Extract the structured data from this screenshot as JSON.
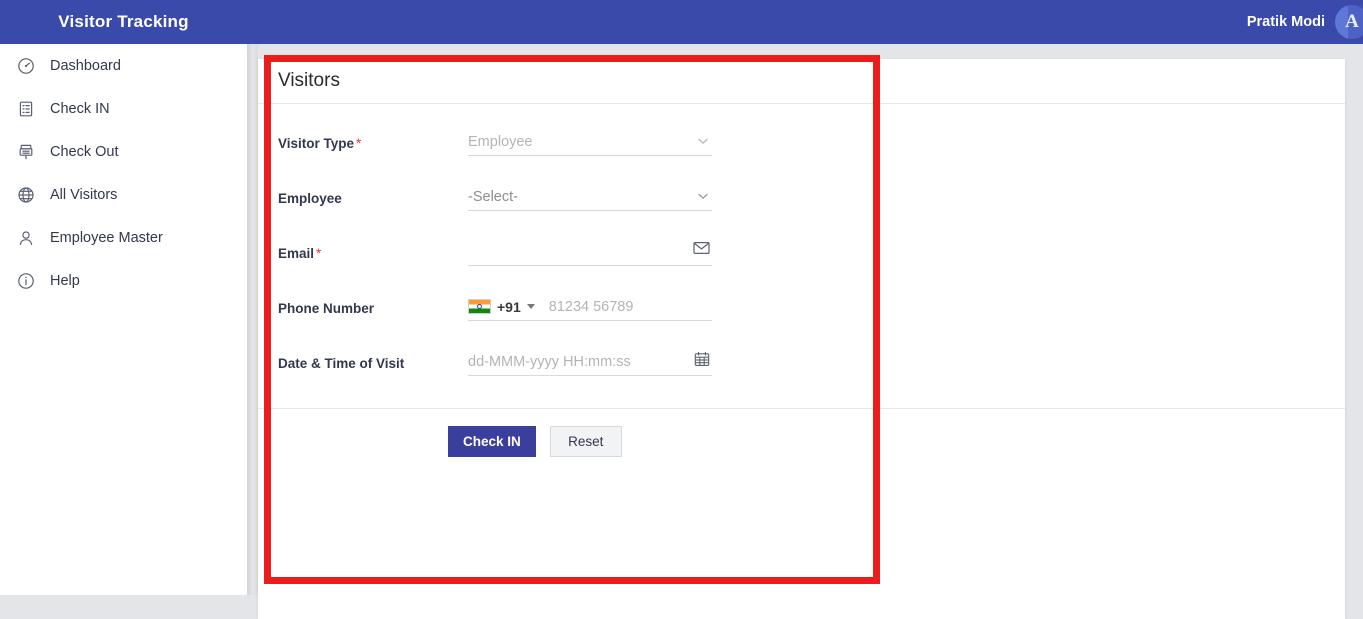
{
  "app": {
    "brand": "Visitor Tracking",
    "user_name": "Pratik Modi",
    "avatar_initial": "A",
    "accent_blue": "#3a4aab",
    "primary_button": "#3a3f9e",
    "annotation_red": "#ec1c1c",
    "required_red": "#e8392b"
  },
  "sidebar": {
    "items": [
      {
        "label": "Dashboard",
        "icon": "dashboard-icon"
      },
      {
        "label": "Check IN",
        "icon": "check-in-icon"
      },
      {
        "label": "Check Out",
        "icon": "check-out-icon"
      },
      {
        "label": "All Visitors",
        "icon": "globe-icon"
      },
      {
        "label": "Employee Master",
        "icon": "user-icon"
      },
      {
        "label": "Help",
        "icon": "info-icon"
      }
    ]
  },
  "card": {
    "title": "Visitors",
    "fields": [
      {
        "label": "Visitor Type",
        "required": true,
        "type": "select",
        "value": "Employee",
        "placeholder": "Employee",
        "icon": "chevron-down-icon"
      },
      {
        "label": "Employee",
        "required": false,
        "type": "select",
        "value": "-Select-",
        "placeholder": "-Select-",
        "icon": "chevron-down-icon"
      },
      {
        "label": "Email",
        "required": true,
        "type": "email",
        "value": "",
        "placeholder": "",
        "icon": "envelope-icon"
      },
      {
        "label": "Phone Number",
        "required": false,
        "type": "phone",
        "value": "",
        "placeholder": "81234 56789",
        "country_code": "+91",
        "country_flag": "india-flag-icon",
        "icon": "caret-down-icon"
      },
      {
        "label": "Date & Time of Visit",
        "required": false,
        "type": "datetime",
        "value": "",
        "placeholder": "dd-MMM-yyyy HH:mm:ss",
        "icon": "calendar-icon"
      }
    ],
    "buttons": {
      "submit": "Check IN",
      "reset": "Reset"
    }
  }
}
